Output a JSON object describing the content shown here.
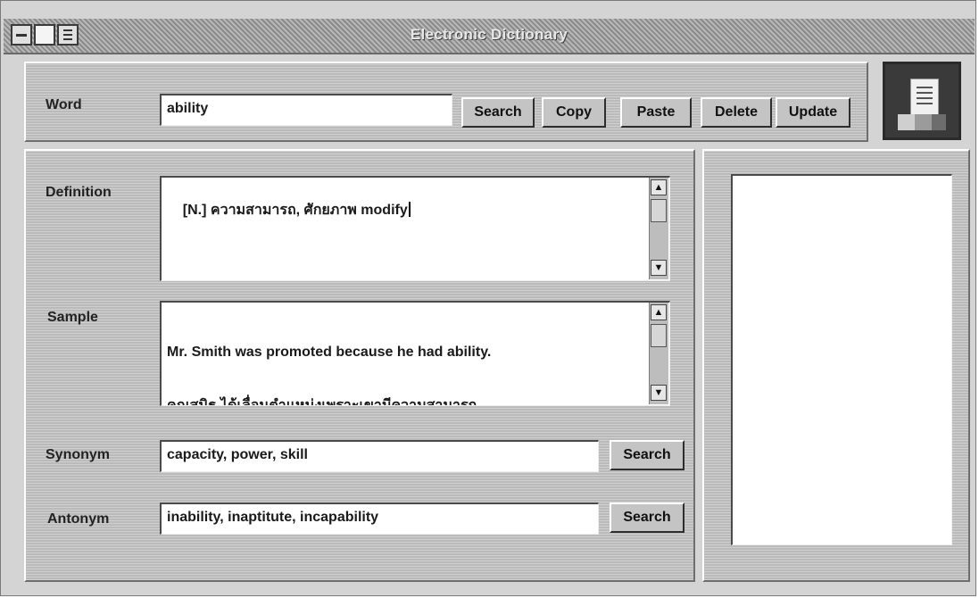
{
  "window": {
    "title": "Electronic Dictionary"
  },
  "word": {
    "label": "Word",
    "value": "ability",
    "buttons": {
      "search": "Search",
      "copy": "Copy",
      "paste": "Paste",
      "delete": "Delete",
      "update": "Update"
    }
  },
  "definition": {
    "label": "Definition",
    "value": "[N.] ความสามารถ, ศักยภาพ modify"
  },
  "sample": {
    "label": "Sample",
    "line1": "Mr. Smith was promoted because he had ability.",
    "line2": "คุณสมิธ ได้เลื่อนตำแหน่งเพราะเขามีความสามารถ."
  },
  "synonym": {
    "label": "Synonym",
    "value": "capacity, power, skill",
    "button": "Search"
  },
  "antonym": {
    "label": "Antonym",
    "value": "inability, inaptitute, incapability",
    "button": "Search"
  },
  "icons": [
    "system-menu-icon",
    "document-icon",
    "list-icon",
    "dictionary-app-icon",
    "scroll-up-icon",
    "scroll-down-icon"
  ],
  "colors": {
    "window_bg": "#d4d4d4",
    "titlebar": "#9a9a9a",
    "field_bg": "#ffffff",
    "text": "#111111"
  }
}
